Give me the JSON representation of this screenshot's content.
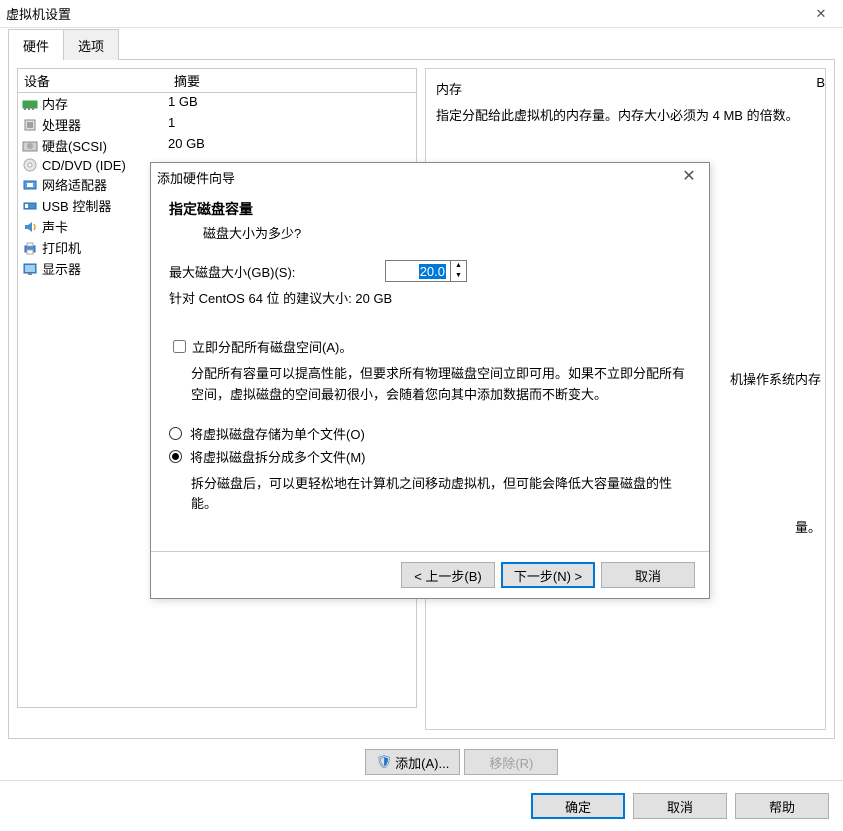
{
  "window": {
    "title": "虚拟机设置"
  },
  "tabs": {
    "hardware": "硬件",
    "options": "选项"
  },
  "hwlist": {
    "col_device": "设备",
    "col_summary": "摘要",
    "items": [
      {
        "name": "内存",
        "summary": "1 GB",
        "icon": "memory-icon"
      },
      {
        "name": "处理器",
        "summary": "1",
        "icon": "cpu-icon"
      },
      {
        "name": "硬盘(SCSI)",
        "summary": "20 GB",
        "icon": "hdd-icon"
      },
      {
        "name": "CD/DVD (IDE)",
        "summary": "",
        "icon": "cd-icon"
      },
      {
        "name": "网络适配器",
        "summary": "",
        "icon": "nic-icon"
      },
      {
        "name": "USB 控制器",
        "summary": "",
        "icon": "usb-icon"
      },
      {
        "name": "声卡",
        "summary": "",
        "icon": "sound-icon"
      },
      {
        "name": "打印机",
        "summary": "",
        "icon": "printer-icon"
      },
      {
        "name": "显示器",
        "summary": "",
        "icon": "display-icon"
      }
    ]
  },
  "rightpane": {
    "group_title": "内存",
    "group_text": "指定分配给此虚拟机的内存量。内存大小必须为 4 MB 的倍数。",
    "stub_mb": "B",
    "stub_os": "机操作系统内存",
    "stub_amount": "量。"
  },
  "buttons": {
    "add": "添加(A)...",
    "remove": "移除(R)",
    "ok": "确定",
    "cancel": "取消",
    "help": "帮助"
  },
  "wizard": {
    "title": "添加硬件向导",
    "heading": "指定磁盘容量",
    "subheading": "磁盘大小为多少?",
    "max_label": "最大磁盘大小(GB)(S):",
    "max_value": "20.0",
    "recommend": "针对 CentOS 64 位 的建议大小: 20 GB",
    "allocate_now_label": "立即分配所有磁盘空间(A)。",
    "allocate_now_checked": false,
    "allocate_explain": "分配所有容量可以提高性能，但要求所有物理磁盘空间立即可用。如果不立即分配所有空间，虚拟磁盘的空间最初很小，会随着您向其中添加数据而不断变大。",
    "single_file_label": "将虚拟磁盘存储为单个文件(O)",
    "split_file_label": "将虚拟磁盘拆分成多个文件(M)",
    "split_selected": true,
    "split_explain": "拆分磁盘后，可以更轻松地在计算机之间移动虚拟机，但可能会降低大容量磁盘的性能。",
    "back": "< 上一步(B)",
    "next": "下一步(N) >",
    "cancel": "取消"
  }
}
